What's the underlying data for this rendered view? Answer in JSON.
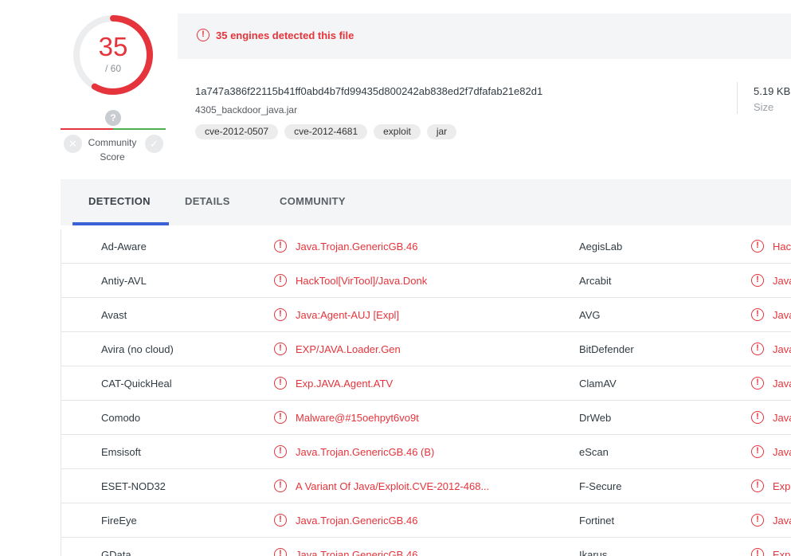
{
  "score": {
    "detected": "35",
    "total": "/ 60",
    "detected_ratio": 0.5833,
    "color": "#e5343b"
  },
  "community": {
    "icon": "question-icon",
    "label_line1": "Community",
    "label_line2": "Score",
    "vote_down_icon": "close-icon",
    "vote_up_icon": "check-icon"
  },
  "banner": {
    "icon": "alert-icon",
    "text": "35 engines detected this file"
  },
  "file": {
    "hash": "1a747a386f22115b41ff0abd4b7fd99435d800242ab838ed2f7dfafab21e82d1",
    "name": "4305_backdoor_java.jar",
    "tags": [
      "cve-2012-0507",
      "cve-2012-4681",
      "exploit",
      "jar"
    ],
    "size_value": "5.19 KB",
    "size_label": "Size"
  },
  "tabs": [
    {
      "label": "DETECTION",
      "active": true
    },
    {
      "label": "DETAILS",
      "active": false
    },
    {
      "label": "COMMUNITY",
      "active": false
    }
  ],
  "detections": [
    {
      "engine1": "Ad-Aware",
      "result1": "Java.Trojan.GenericGB.46",
      "engine2": "AegisLab",
      "result2": "Hac"
    },
    {
      "engine1": "Antiy-AVL",
      "result1": "HackTool[VirTool]/Java.Donk",
      "engine2": "Arcabit",
      "result2": "Java"
    },
    {
      "engine1": "Avast",
      "result1": "Java:Agent-AUJ [Expl]",
      "engine2": "AVG",
      "result2": "Java"
    },
    {
      "engine1": "Avira (no cloud)",
      "result1": "EXP/JAVA.Loader.Gen",
      "engine2": "BitDefender",
      "result2": "Java"
    },
    {
      "engine1": "CAT-QuickHeal",
      "result1": "Exp.JAVA.Agent.ATV",
      "engine2": "ClamAV",
      "result2": "Java"
    },
    {
      "engine1": "Comodo",
      "result1": "Malware@#15oehpyt6vo9t",
      "engine2": "DrWeb",
      "result2": "Java"
    },
    {
      "engine1": "Emsisoft",
      "result1": "Java.Trojan.GenericGB.46 (B)",
      "engine2": "eScan",
      "result2": "Java"
    },
    {
      "engine1": "ESET-NOD32",
      "result1": "A Variant Of Java/Exploit.CVE-2012-468...",
      "engine2": "F-Secure",
      "result2": "Expl"
    },
    {
      "engine1": "FireEye",
      "result1": "Java.Trojan.GenericGB.46",
      "engine2": "Fortinet",
      "result2": "Java"
    },
    {
      "engine1": "GData",
      "result1": "Java.Trojan.GenericGB.46",
      "engine2": "Ikarus",
      "result2": "Expl"
    }
  ]
}
